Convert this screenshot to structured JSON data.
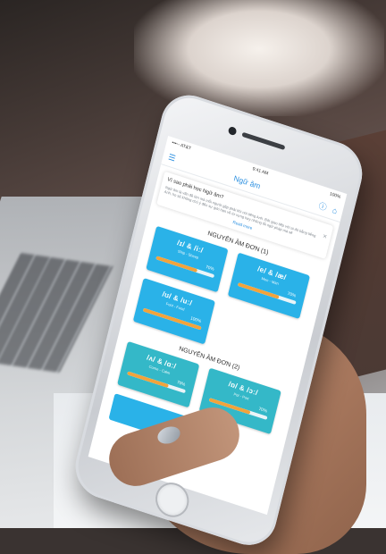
{
  "status": {
    "carrier": "•••◦◦ AT&T",
    "time": "9:41 AM",
    "battery": "100%"
  },
  "nav": {
    "title": "Ngữ âm"
  },
  "info": {
    "question": "Vì sao phải học Ngữ âm?",
    "body": "Ngữ âm là vấn đề lớn mà mỗi người gặp phải khi nói tiếng Anh. Bởi giao tiếp với ai đó bằng tiếng Anh, họ sẽ không chú ý đến sự giới hạn về từ vựng hay những lỗi ngữ pháp mà sẽ",
    "read_more": "Read more",
    "close": "✕"
  },
  "sections": [
    {
      "title": "NGUYÊN ÂM ĐƠN (1)",
      "items": [
        {
          "symbol": "/ɪ/ & /iː/",
          "examples": "Ship - Sheep",
          "percent_label": "70%",
          "progress": 0.7,
          "color": "#2ab2e8"
        },
        {
          "symbol": "/e/ & /æ/",
          "examples": "Men - Man",
          "percent_label": "70%",
          "progress": 0.7,
          "color": "#2ab2e8"
        },
        {
          "symbol": "/ʊ/ & /uː/",
          "examples": "Foot - Food",
          "percent_label": "100%",
          "progress": 1.0,
          "color": "#2ab2e8"
        }
      ]
    },
    {
      "title": "NGUYÊN ÂM ĐƠN (2)",
      "items": [
        {
          "symbol": "/ʌ/ & /ɑː/",
          "examples": "Come - Calm",
          "percent_label": "70%",
          "progress": 0.7,
          "color": "#34b8c8"
        },
        {
          "symbol": "/ɒ/ & /ɔː/",
          "examples": "Pot - Port",
          "percent_label": "70%",
          "progress": 0.7,
          "color": "#34b8c8"
        }
      ]
    }
  ]
}
